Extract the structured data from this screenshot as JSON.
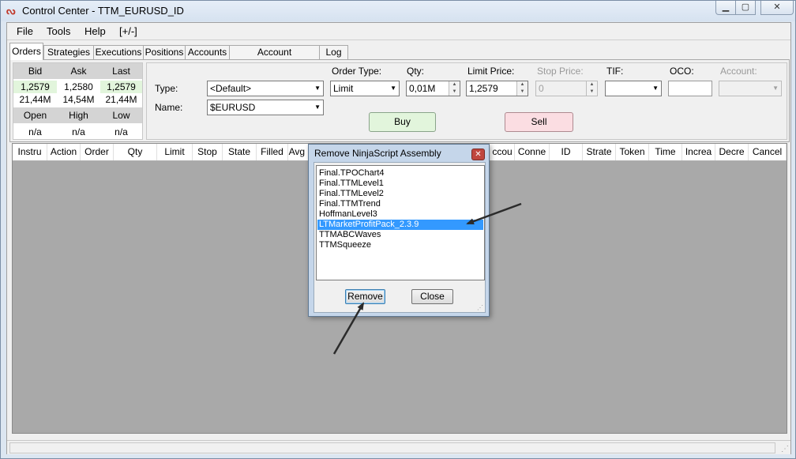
{
  "window": {
    "title": "Control Center - TTM_EURUSD_ID",
    "app_icon": "ninjatrader-logo-icon"
  },
  "menu": {
    "items": [
      "File",
      "Tools",
      "Help",
      "[+/-]"
    ]
  },
  "tabs": [
    {
      "label": "Orders",
      "active": true
    },
    {
      "label": "Strategies",
      "active": false
    },
    {
      "label": "Executions",
      "active": false
    },
    {
      "label": "Positions",
      "active": false
    },
    {
      "label": "Accounts",
      "active": false
    },
    {
      "label": "Account Performance",
      "active": false
    },
    {
      "label": "Log",
      "active": false
    }
  ],
  "quote": {
    "headers1": [
      "Bid",
      "Ask",
      "Last"
    ],
    "prices": [
      "1,2579",
      "1,2580",
      "1,2579"
    ],
    "sizes": [
      "21,44M",
      "14,54M",
      "21,44M"
    ],
    "headers2": [
      "Open",
      "High",
      "Low"
    ],
    "ohl": [
      "n/a",
      "n/a",
      "n/a"
    ]
  },
  "order_form": {
    "type_label": "Type:",
    "type_value": "<Default>",
    "name_label": "Name:",
    "name_value": "$EURUSD",
    "order_type_label": "Order Type:",
    "order_type_value": "Limit",
    "qty_label": "Qty:",
    "qty_value": "0,01M",
    "limit_price_label": "Limit Price:",
    "limit_price_value": "1,2579",
    "stop_price_label": "Stop Price:",
    "stop_price_value": "0",
    "tif_label": "TIF:",
    "tif_value": "",
    "oco_label": "OCO:",
    "oco_value": "",
    "account_label": "Account:",
    "account_value": "",
    "buy_label": "Buy",
    "sell_label": "Sell",
    "buy_color": "#e2f5dc",
    "sell_color": "#fbdde2"
  },
  "grid": {
    "columns": [
      "Instru",
      "Action",
      "Order",
      "Qty",
      "Limit",
      "Stop",
      "State",
      "Filled",
      "Avg Pr",
      "ccou",
      "Conne",
      "ID",
      "Strate",
      "Token",
      "Time",
      "Increa",
      "Decre",
      "Cancel"
    ],
    "background": "#a9a9a9"
  },
  "dialog": {
    "title": "Remove NinjaScript Assembly",
    "items": [
      "Final.TPOChart4",
      "Final.TTMLevel1",
      "Final.TTMLevel2",
      "Final.TTMTrend",
      "HoffmanLevel3",
      "LTMarketProfitPack_2.3.9",
      "TTMABCWaves",
      "TTMSqueeze"
    ],
    "selected_index": 5,
    "remove_label": "Remove",
    "close_label": "Close",
    "selection_color": "#3399ff"
  }
}
